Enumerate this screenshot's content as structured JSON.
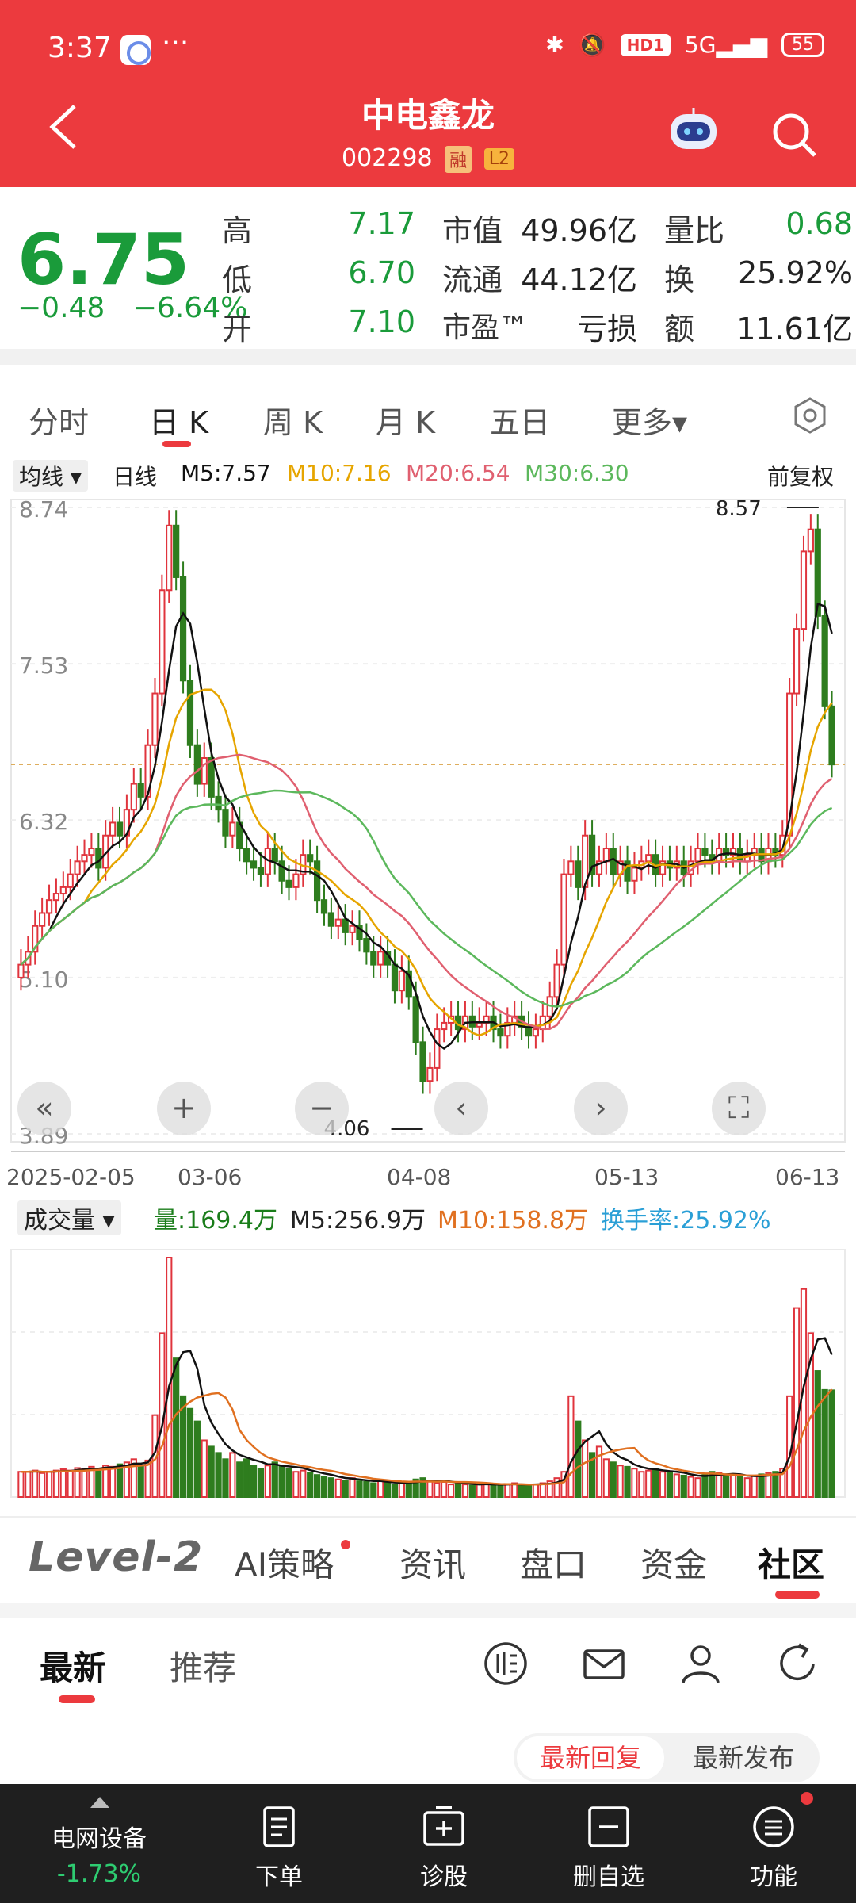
{
  "status": {
    "time": "3:37",
    "more": "···",
    "hd": "HD1",
    "net": "5G",
    "battery": "55"
  },
  "header": {
    "title": "中电鑫龙",
    "code": "002298",
    "tag_rong": "融",
    "tag_l2": "L2"
  },
  "quote": {
    "price": "6.75",
    "change": "−0.48",
    "change_pct": "−6.64%",
    "high_label": "高",
    "high": "7.17",
    "low_label": "低",
    "low": "6.70",
    "open_label": "开",
    "open": "7.10",
    "mcap_label": "市值",
    "mcap": "49.96亿",
    "float_label": "流通",
    "float": "44.12亿",
    "pe_label": "市盈™",
    "pe": "亏损",
    "vr_label": "量比",
    "vr": "0.68",
    "turn_label": "换",
    "turn": "25.92%",
    "amt_label": "额",
    "amt": "11.61亿"
  },
  "ktabs": [
    "分时",
    "日 K",
    "周 K",
    "月 K",
    "五日",
    "更多▾"
  ],
  "ma": {
    "type": "均线 ▾",
    "period": "日线",
    "m5": "M5:7.57",
    "m10": "M10:7.16",
    "m20": "M20:6.54",
    "m30": "M30:6.30",
    "adjust": "前复权"
  },
  "colors": {
    "up": "#e0343d",
    "down": "#2e7d1e",
    "m5": "#111111",
    "m10": "#e6a500",
    "m20": "#e06070",
    "m30": "#5cb85c",
    "accent": "#ec3a3e"
  },
  "chart_data": [
    {
      "type": "candlestick",
      "title": "",
      "y_ticks": [
        "8.74",
        "7.53",
        "6.32",
        "5.10",
        "3.89"
      ],
      "x_ticks": [
        "2025-02-05",
        "03-06",
        "04-08",
        "05-13",
        "06-13"
      ],
      "annotations": {
        "high": "8.57",
        "low": "4.06"
      },
      "ylim": [
        3.89,
        8.74
      ],
      "close": [
        5.2,
        5.3,
        5.5,
        5.6,
        5.7,
        5.75,
        5.8,
        5.9,
        6.0,
        6.05,
        6.1,
        5.95,
        6.2,
        6.3,
        6.2,
        6.4,
        6.6,
        6.5,
        6.9,
        7.3,
        8.1,
        8.6,
        8.2,
        7.4,
        6.9,
        6.6,
        6.8,
        6.5,
        6.4,
        6.2,
        6.3,
        6.1,
        6.0,
        5.95,
        5.9,
        6.1,
        6.0,
        5.85,
        5.8,
        5.9,
        6.05,
        6.0,
        5.7,
        5.6,
        5.5,
        5.55,
        5.45,
        5.5,
        5.4,
        5.3,
        5.2,
        5.3,
        5.2,
        5.0,
        5.15,
        4.95,
        4.6,
        4.3,
        4.4,
        4.7,
        4.75,
        4.8,
        4.7,
        4.8,
        4.72,
        4.75,
        4.8,
        4.7,
        4.65,
        4.75,
        4.8,
        4.72,
        4.65,
        4.7,
        4.8,
        4.95,
        5.2,
        5.9,
        6.0,
        5.8,
        6.2,
        5.9,
        6.0,
        6.1,
        5.9,
        6.0,
        5.85,
        5.95,
        6.0,
        6.05,
        5.9,
        6.0,
        5.95,
        6.0,
        5.9,
        6.0,
        6.1,
        6.05,
        6.0,
        6.1,
        6.05,
        6.1,
        6.0,
        6.05,
        6.1,
        6.0,
        6.1,
        6.05,
        6.2,
        7.3,
        7.8,
        8.4,
        8.57,
        7.9,
        7.2,
        6.75
      ],
      "volume_ticks": [],
      "volume_label": "成交量 ▾",
      "volume_stats": {
        "vol": "量:169.4万",
        "m5": "M5:256.9万",
        "m10": "M10:158.8万",
        "turnover": "换手率:25.92%"
      },
      "volume": [
        40,
        40,
        42,
        38,
        40,
        42,
        44,
        42,
        46,
        45,
        48,
        44,
        50,
        48,
        52,
        55,
        60,
        50,
        58,
        130,
        260,
        380,
        220,
        160,
        140,
        120,
        90,
        80,
        70,
        60,
        70,
        55,
        60,
        50,
        45,
        50,
        55,
        48,
        45,
        40,
        42,
        38,
        35,
        32,
        30,
        28,
        26,
        30,
        25,
        24,
        22,
        26,
        24,
        20,
        22,
        24,
        28,
        30,
        26,
        22,
        24,
        20,
        22,
        20,
        18,
        20,
        22,
        20,
        18,
        20,
        22,
        20,
        18,
        20,
        22,
        25,
        30,
        40,
        160,
        120,
        90,
        70,
        80,
        60,
        55,
        50,
        48,
        45,
        40,
        42,
        45,
        40,
        38,
        36,
        34,
        32,
        30,
        35,
        40,
        38,
        36,
        34,
        32,
        30,
        34,
        36,
        38,
        40,
        45,
        160,
        300,
        330,
        260,
        200,
        170,
        169.4
      ]
    }
  ],
  "lower_tabs": {
    "logo": "Level-2",
    "items": [
      "AI策略",
      "资讯",
      "盘口",
      "资金",
      "社区"
    ]
  },
  "community": {
    "tabs": [
      "最新",
      "推荐"
    ],
    "sort_on": "最新回复",
    "sort_off": "最新发布"
  },
  "bottom_nav": {
    "sector": "电网设备",
    "sector_pct": "-1.73%",
    "items": [
      "下单",
      "诊股",
      "删自选",
      "功能"
    ]
  }
}
